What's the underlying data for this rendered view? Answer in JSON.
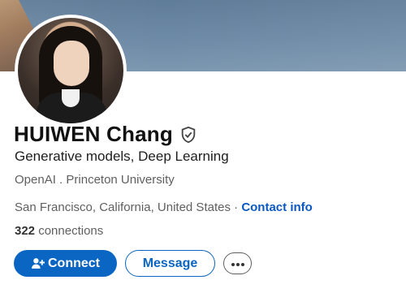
{
  "profile": {
    "name": "HUIWEN Chang",
    "headline": "Generative models, Deep Learning",
    "org": "OpenAI",
    "org_separator": " . ",
    "school": "Princeton University",
    "location": "San Francisco, California, United States",
    "location_separator": " · ",
    "contact_label": "Contact info",
    "connections_count": "322",
    "connections_label": " connections"
  },
  "actions": {
    "connect_label": "Connect",
    "message_label": "Message",
    "more_label": "···"
  },
  "icons": {
    "verified": "shield-check-icon",
    "connect": "add-user-icon",
    "more": "ellipsis-icon"
  },
  "colors": {
    "accent": "#0a66c2",
    "link": "#0a58c2",
    "banner": "#6d8aa6"
  }
}
